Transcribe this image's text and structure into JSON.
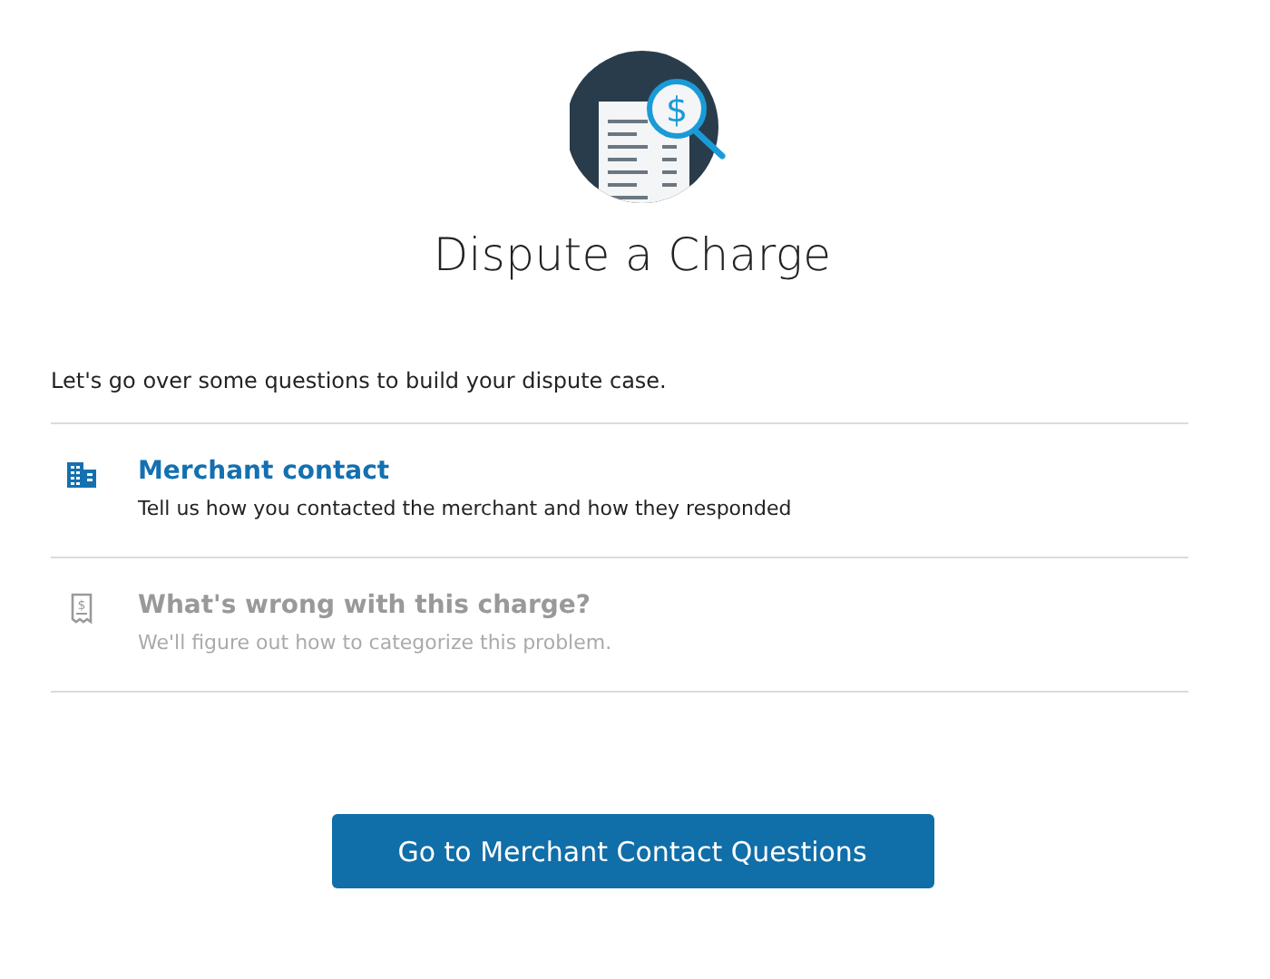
{
  "hero_icon": {
    "symbol": "$"
  },
  "title": "Dispute a Charge",
  "intro": "Let's go over some questions to build your dispute case.",
  "steps": [
    {
      "kind": "merchant",
      "title": "Merchant contact",
      "description": "Tell us how you contacted the merchant and how they responded",
      "disabled": false
    },
    {
      "kind": "charge",
      "symbol": "$",
      "title": "What's wrong with this charge?",
      "description": "We'll figure out how to categorize this problem.",
      "disabled": true
    }
  ],
  "button": "Go to Merchant Contact Questions"
}
